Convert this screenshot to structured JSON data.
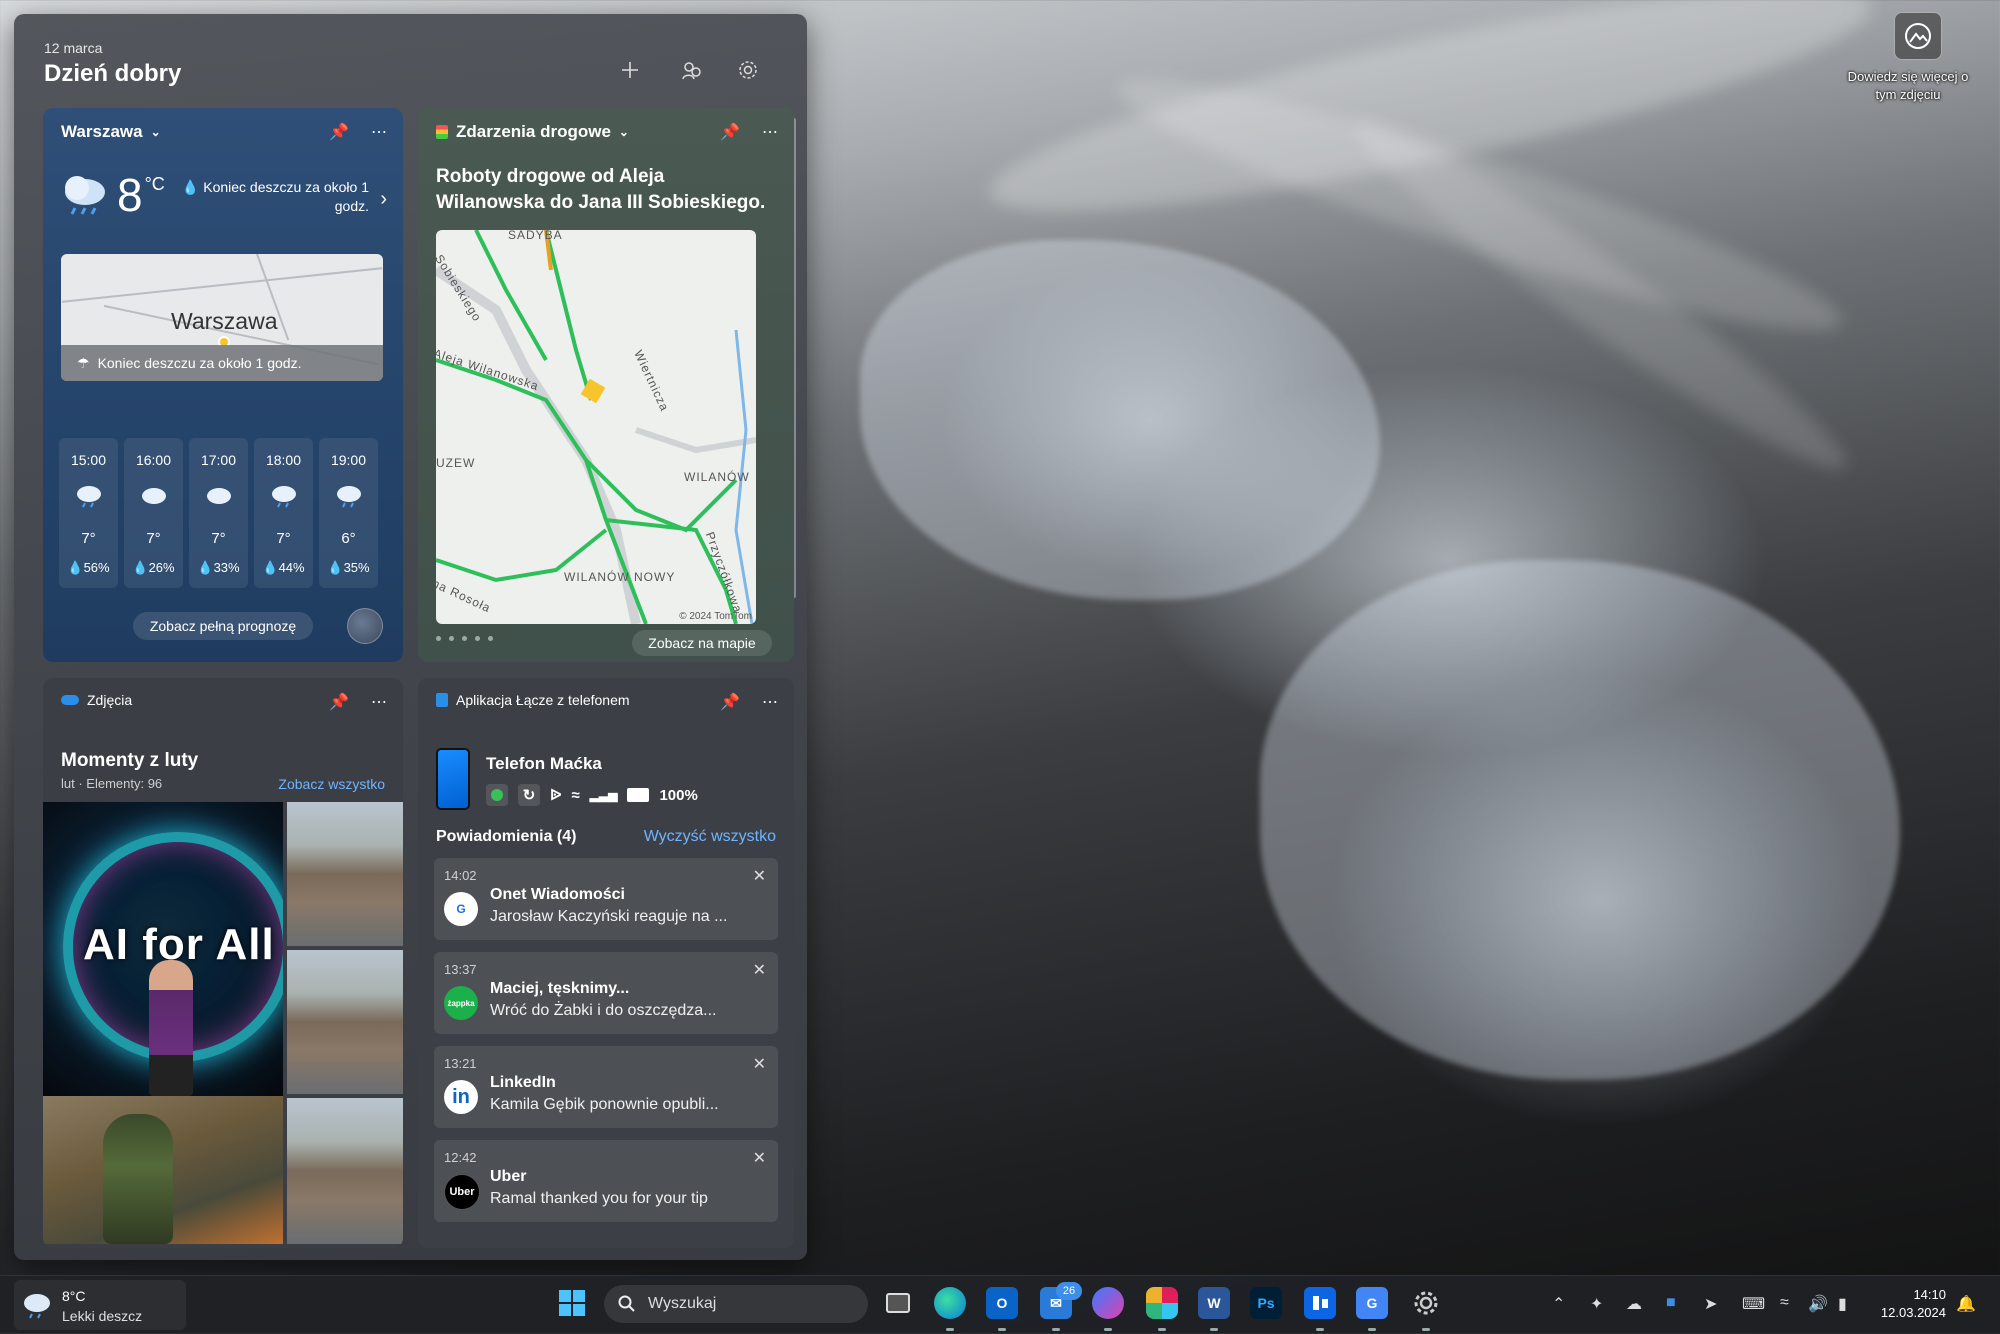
{
  "desktop": {
    "info_label": "Dowiedz się więcej o tym zdjęciu"
  },
  "panel": {
    "date": "12 marca",
    "greeting": "Dzień dobry"
  },
  "weather": {
    "location": "Warszawa",
    "temp": "8",
    "unit": "°C",
    "rain_note": "Koniec deszczu za około 1 godz.",
    "map_city": "Warszawa",
    "map_note": "Koniec deszczu za około 1 godz.",
    "hours": [
      {
        "time": "15:00",
        "temp": "7°",
        "precip": "56%"
      },
      {
        "time": "16:00",
        "temp": "7°",
        "precip": "26%"
      },
      {
        "time": "17:00",
        "temp": "7°",
        "precip": "33%"
      },
      {
        "time": "18:00",
        "temp": "7°",
        "precip": "44%"
      },
      {
        "time": "19:00",
        "temp": "6°",
        "precip": "35%"
      }
    ],
    "forecast_button": "Zobacz pełną prognozę"
  },
  "traffic": {
    "title": "Zdarzenia drogowe",
    "headline": "Roboty drogowe od Aleja Wilanowska do Jana III Sobieskiego.",
    "map_labels": {
      "sadyba": "SADYBA",
      "sobieskiego": "Sobieskiego",
      "wilanowska": "Aleja Wilanowska",
      "wiertnicza": "Wiertnicza",
      "zew": "UZEW",
      "wilanow": "WILANÓW",
      "wilanow_nowy": "WILANÓW NOWY",
      "przyczolkowa": "Przyczółkowa",
      "rosola": "na Rosoła",
      "copyright": "© 2024 TomTom"
    },
    "map_button": "Zobacz na mapie"
  },
  "photos": {
    "source": "Zdjęcia",
    "title": "Momenty z luty",
    "subtitle": "lut · Elementy: 96",
    "see_all": "Zobacz wszystko",
    "big_text": "AI for All"
  },
  "phone": {
    "app": "Aplikacja Łącze z telefonem",
    "device": "Telefon Maćka",
    "battery": "100%",
    "notifications_header": "Powiadomienia (4)",
    "clear_all": "Wyczyść wszystko",
    "notifications": [
      {
        "time": "14:02",
        "title": "Onet Wiadomości",
        "body": "Jarosław Kaczyński reaguje na ...",
        "icon_text": "G"
      },
      {
        "time": "13:37",
        "title": "Maciej, tęsknimy...",
        "body": "Wróć do Żabki i do oszczędza...",
        "icon_text": "żappka"
      },
      {
        "time": "13:21",
        "title": "LinkedIn",
        "body": "Kamila Gębik ponownie opubli...",
        "icon_text": "in"
      },
      {
        "time": "12:42",
        "title": "Uber",
        "body": "Ramal thanked you for your tip",
        "icon_text": "Uber"
      }
    ]
  },
  "taskbar": {
    "weather_temp": "8°C",
    "weather_cond": "Lekki deszcz",
    "search_placeholder": "Wyszukaj",
    "badge_count": "26",
    "time": "14:10",
    "date": "12.03.2024"
  },
  "colors": {
    "accent": "#6fb4ff",
    "route_green": "#2fbf5a",
    "incident_yellow": "#f6c52c"
  }
}
